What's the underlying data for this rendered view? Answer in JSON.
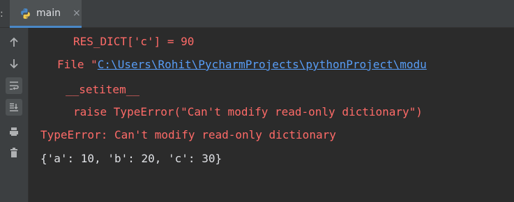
{
  "tabbar": {
    "prefix": ":",
    "tab": {
      "label": "main",
      "icon": "python-icon",
      "close": "×"
    }
  },
  "toolbar": {
    "buttons": [
      {
        "icon": "arrow-up-icon"
      },
      {
        "icon": "arrow-down-icon"
      },
      {
        "icon": "soft-wrap-icon",
        "active": true
      },
      {
        "icon": "scroll-to-end-icon",
        "active": true
      },
      {
        "icon": "print-icon"
      },
      {
        "icon": "trash-icon"
      }
    ]
  },
  "console": {
    "lines": [
      {
        "kind": "error",
        "text": "RES_DICT['c'] = 90"
      },
      {
        "kind": "error-link",
        "prefix": "File \"",
        "link": "C:\\Users\\Rohit\\PycharmProjects\\pythonProject\\modu"
      },
      {
        "kind": "error",
        "text": "__setitem__"
      },
      {
        "kind": "error",
        "text": "raise TypeError(\"Can't modify read-only dictionary\")"
      },
      {
        "kind": "error",
        "text": "TypeError: Can't modify read-only dictionary"
      },
      {
        "kind": "output",
        "text": "{'a': 10, 'b': 20, 'c': 30}"
      }
    ]
  },
  "colors": {
    "background": "#2b2b2b",
    "error": "#ff6b68",
    "link": "#589df6",
    "output": "#dfe1e5",
    "tab_accent": "#4a88c7"
  }
}
